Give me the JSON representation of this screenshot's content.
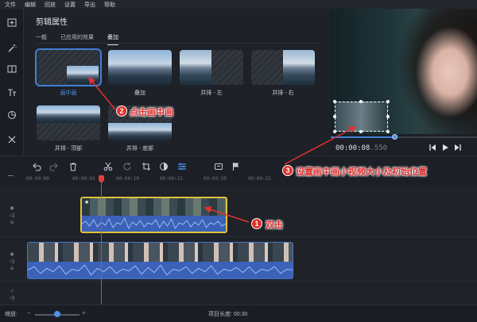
{
  "menu": [
    "文件",
    "编辑",
    "回放",
    "设置",
    "导出",
    "帮助"
  ],
  "props": {
    "title": "剪辑属性",
    "tabs": [
      "一般",
      "已应用的效果",
      "叠加"
    ],
    "active_tab": "叠加",
    "presets": [
      {
        "label": "画中画"
      },
      {
        "label": "叠加"
      },
      {
        "label": "并排 - 左"
      },
      {
        "label": "并排 - 右"
      },
      {
        "label": "并排 - 顶部"
      },
      {
        "label": "并排 - 底部"
      }
    ],
    "selected_preset": "画中画"
  },
  "player": {
    "timecode_main": "00:00:08",
    "timecode_ms": ".550",
    "progress": 0.44
  },
  "ruler": [
    "00:00:00",
    "00:00:05",
    "00:00:10",
    "00:00:15",
    "00:00:20",
    "00:00:25"
  ],
  "status": {
    "zoom_label": "缩放:",
    "zoom_level": 0.5,
    "project_length_label": "项目长度:",
    "project_length": "00:30"
  },
  "annotations": {
    "step1": {
      "num": "1",
      "text": "双击"
    },
    "step2": {
      "num": "2",
      "text": "点击画中画"
    },
    "step3": {
      "num": "3",
      "text": "设置画中画小视频大小及初始位置"
    }
  },
  "colors": {
    "accent": "#3f7fd8",
    "selection": "#e0c23a",
    "playhead": "#e0413c",
    "annotation": "#e03030"
  }
}
